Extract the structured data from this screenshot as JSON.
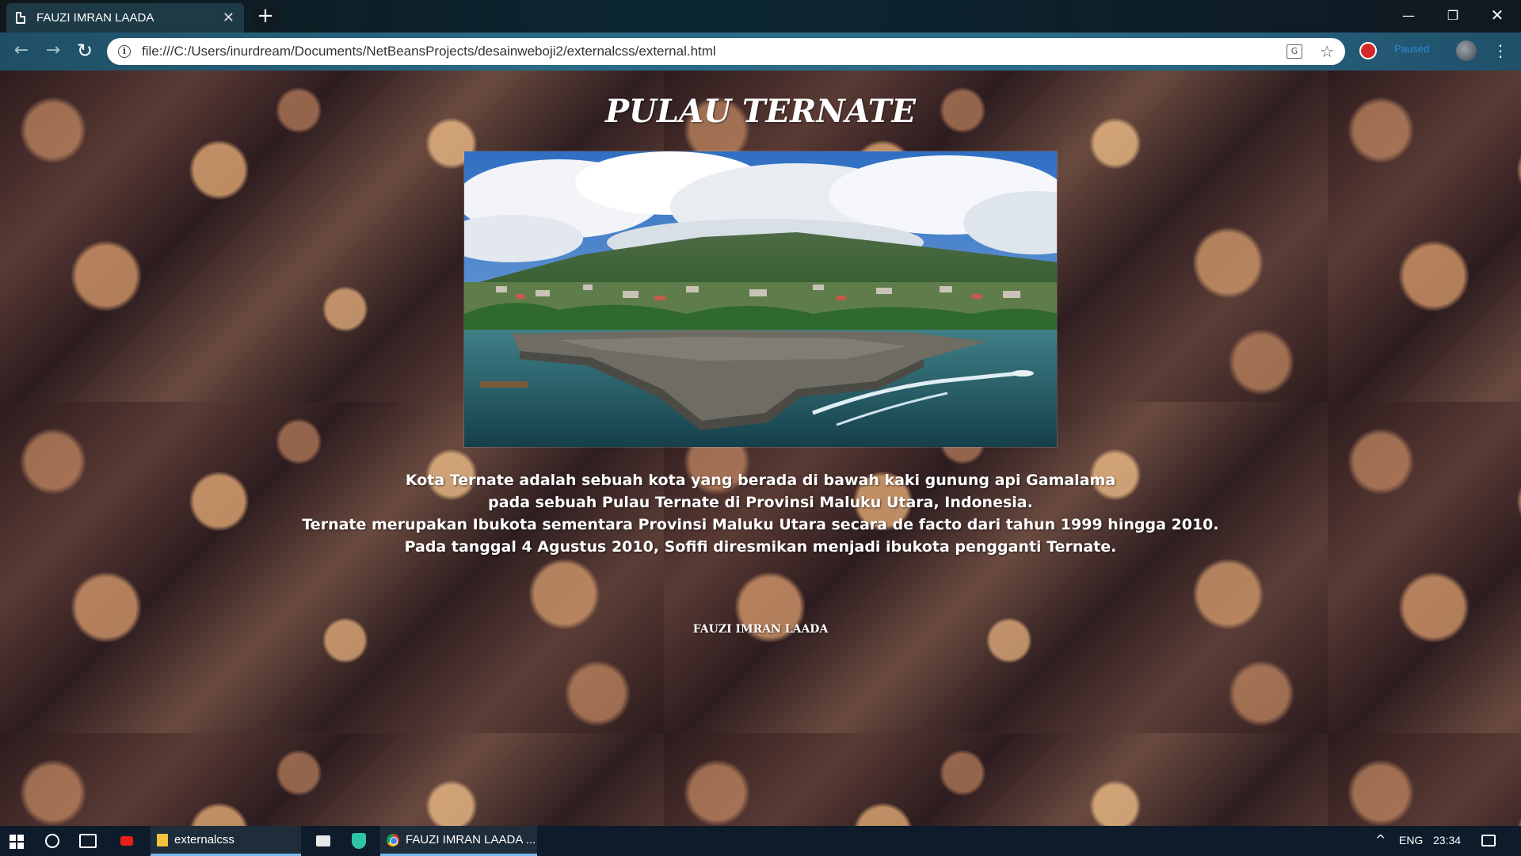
{
  "browser": {
    "tab_title": "FAUZI IMRAN LAADA",
    "new_tab_symbol": "+",
    "url": "file:///C:/Users/inurdream/Documents/NetBeansProjects/desainweboji2/externalcss/external.html",
    "profile_label": "Paused",
    "icons": [
      "doc-icon",
      "close-icon",
      "back-icon",
      "forward-icon",
      "reload-icon",
      "info-icon",
      "translate-icon",
      "star-icon",
      "extension-icon",
      "avatar",
      "menu-icon",
      "minimize-icon",
      "maximize-icon",
      "window-close-icon"
    ]
  },
  "page": {
    "title": "PULAU TERNATE",
    "description": [
      "Kota Ternate adalah sebuah kota yang berada di bawah kaki gunung api Gamalama",
      "pada sebuah Pulau Ternate di Provinsi Maluku Utara, Indonesia.",
      "Ternate merupakan Ibukota sementara Provinsi Maluku Utara secara de facto dari tahun 1999 hingga 2010.",
      "Pada tanggal 4 Agustus 2010, Sofifi diresmikan menjadi ibukota pengganti Ternate."
    ],
    "author": "FAUZI IMRAN LAADA",
    "background": "clove-spice-texture",
    "hero_image": "fort-oranje-ternate-aerial-photo"
  },
  "taskbar": {
    "folder_app": "externalcss",
    "chrome_app": "FAUZI IMRAN LAADA ...",
    "tray_up": "^",
    "language": "ENG",
    "time": "23:34",
    "icons": [
      "windows-start-icon",
      "search-icon",
      "task-view-icon",
      "youtube-icon",
      "folder-icon",
      "mail-icon",
      "shield-icon",
      "chrome-icon",
      "notification-icon"
    ]
  },
  "colors": {
    "titlebar": "#0b2733",
    "toolbar": "#2b6a86",
    "taskbar": "#0d1b2a",
    "page_text": "#ffffff"
  }
}
